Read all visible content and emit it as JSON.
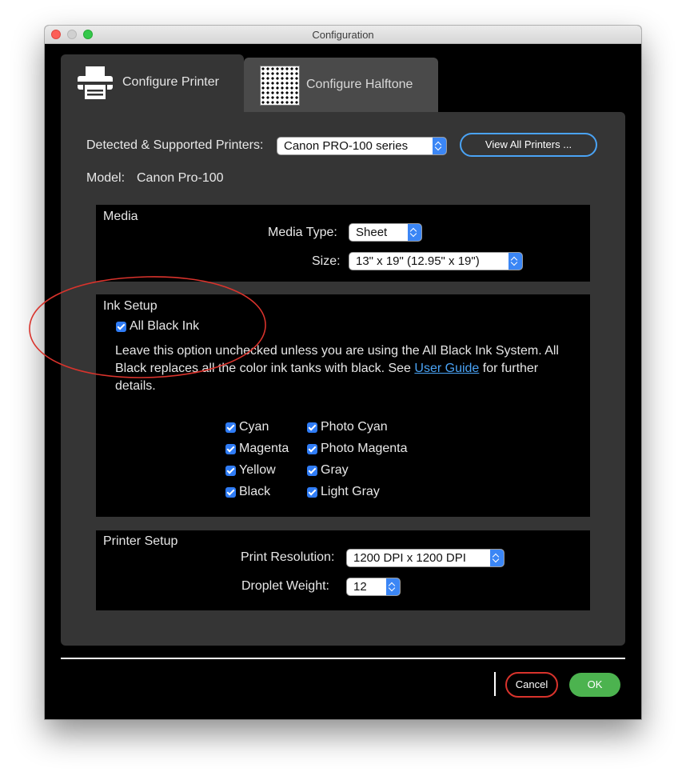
{
  "window": {
    "title": "Configuration"
  },
  "tabs": [
    {
      "label": "Configure Printer",
      "icon": "printer-icon",
      "selected": true
    },
    {
      "label": "Configure Halftone",
      "icon": "halftone-pattern-icon",
      "selected": false
    }
  ],
  "printer": {
    "detected_label": "Detected & Supported Printers:",
    "detected_value": "Canon PRO-100 series",
    "view_all_label": "View All Printers ...",
    "model_label": "Model:",
    "model_value": "Canon Pro-100"
  },
  "media": {
    "title": "Media",
    "type_label": "Media Type:",
    "type_value": "Sheet",
    "size_label": "Size:",
    "size_value": "13\" x 19\" (12.95\" x 19\")"
  },
  "ink_setup": {
    "title": "Ink Setup",
    "all_black_label": "All Black Ink",
    "all_black_checked": true,
    "description_before": "Leave this option unchecked unless you are using the All Black Ink System. All Black replaces all the color ink tanks with black. See ",
    "description_link": "User Guide",
    "description_after": " for further details.",
    "inks": [
      {
        "label": "Cyan",
        "checked": true
      },
      {
        "label": "Photo Cyan",
        "checked": true
      },
      {
        "label": "Magenta",
        "checked": true
      },
      {
        "label": "Photo Magenta",
        "checked": true
      },
      {
        "label": "Yellow",
        "checked": true
      },
      {
        "label": "Gray",
        "checked": true
      },
      {
        "label": "Black",
        "checked": true
      },
      {
        "label": "Light Gray",
        "checked": true
      }
    ]
  },
  "printer_setup": {
    "title": "Printer Setup",
    "resolution_label": "Print Resolution:",
    "resolution_value": "1200 DPI x 1200 DPI",
    "droplet_label": "Droplet Weight:",
    "droplet_value": "12"
  },
  "footer": {
    "cancel_label": "Cancel",
    "ok_label": "OK"
  },
  "colors": {
    "accent_blue": "#3b86f5",
    "link_blue": "#4aa3f5",
    "ok_green": "#4cb34f",
    "annotation_red": "#d9332c",
    "panel": "#353535"
  }
}
